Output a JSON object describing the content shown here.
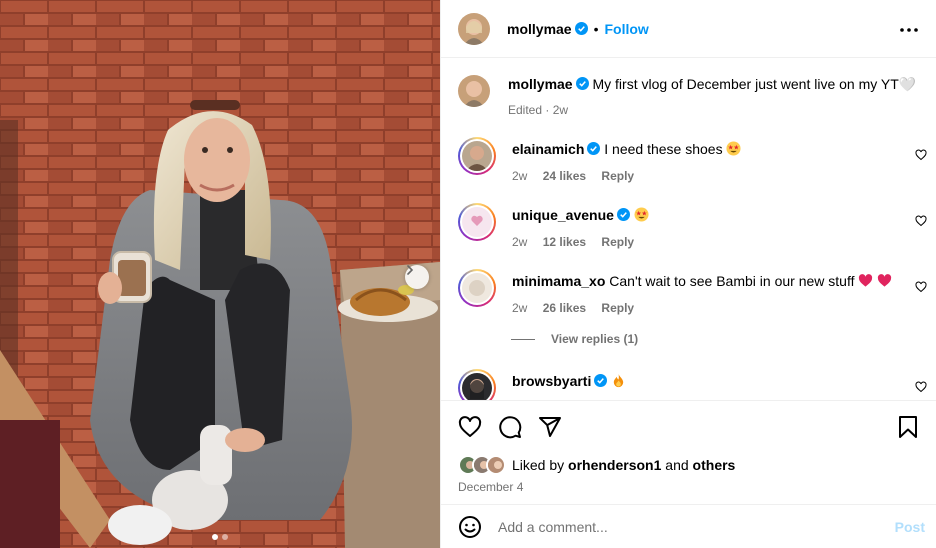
{
  "post": {
    "author": "mollymae",
    "follow_label": "Follow",
    "separator": "•",
    "verified": true
  },
  "caption": {
    "username": "mollymae",
    "text": "My first vlog of December just went live on my YT🤍",
    "meta": "Edited · 2w"
  },
  "comments": [
    {
      "username": "elainamich",
      "text": "I need these shoes",
      "emoji": "star-struck",
      "age": "2w",
      "likes": "24 likes",
      "reply": "Reply"
    },
    {
      "username": "unique_avenue",
      "text": "",
      "emoji": "star-struck",
      "age": "2w",
      "likes": "12 likes",
      "reply": "Reply"
    },
    {
      "username": "minimama_xo",
      "text": "Can't wait to see Bambi in our new stuff",
      "emoji": "two-red-hearts",
      "age": "2w",
      "likes": "26 likes",
      "reply": "Reply"
    },
    {
      "username": "browsbyarti",
      "text": "",
      "emoji": "fire"
    }
  ],
  "view_replies": "View replies (1)",
  "likes": {
    "prefix": "Liked by",
    "user": "orhenderson1",
    "joiner": "and",
    "others": "others"
  },
  "date": "December 4",
  "add_comment": {
    "placeholder": "Add a comment...",
    "post_label": "Post"
  },
  "colors": {
    "accent": "#0095f6",
    "muted": "#737373",
    "post_disabled": "#b2dffc",
    "divider": "#efefef"
  },
  "icons": [
    "more-icon",
    "heart-icon",
    "comment-icon",
    "share-icon",
    "bookmark-icon",
    "emoji-icon",
    "chevron-right-icon"
  ]
}
